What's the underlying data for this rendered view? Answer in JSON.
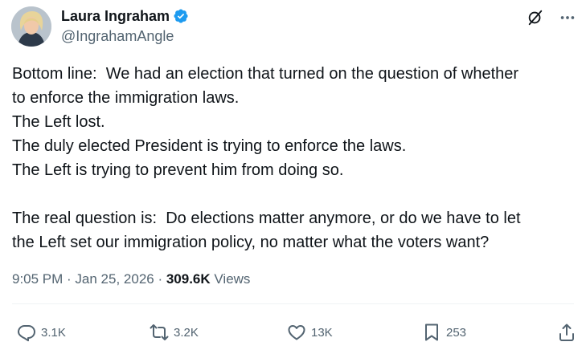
{
  "author": {
    "display_name": "Laura Ingraham",
    "handle": "@IngrahamAngle",
    "verified": true,
    "verified_color": "#1d9bf0"
  },
  "header_icons": [
    "grok-icon",
    "more-icon"
  ],
  "tweet": {
    "lines": [
      "Bottom line:  We had an election that turned on the question of whether",
      "to enforce the immigration laws.",
      "The Left lost.",
      "The duly elected President is trying to enforce the laws.",
      "The Left is trying to prevent him from doing so.",
      "",
      "The real question is:  Do elections matter anymore, or do we have to let",
      "the Left set our immigration policy, no matter what the voters want?"
    ]
  },
  "meta": {
    "time": "9:05 PM",
    "separator": " · ",
    "date": "Jan 25, 2026",
    "views_count": "309.6K",
    "views_label": " Views"
  },
  "actions": {
    "replies": "3.1K",
    "reposts": "3.2K",
    "likes": "13K",
    "bookmarks": "253"
  },
  "colors": {
    "text": "#0f1419",
    "secondary": "#536471",
    "divider": "#eff3f4"
  }
}
